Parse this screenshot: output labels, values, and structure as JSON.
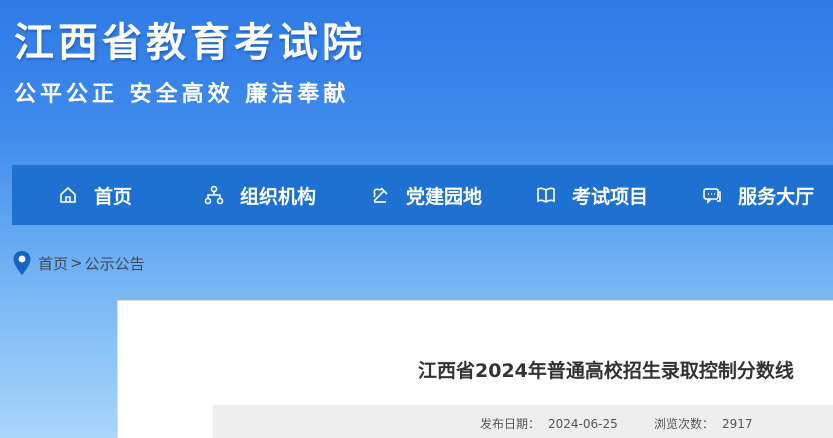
{
  "header": {
    "title": "江西省教育考试院",
    "slogan": "公平公正 安全高效 廉洁奉献"
  },
  "nav": {
    "items": [
      {
        "label": "首页",
        "icon": "home-icon"
      },
      {
        "label": "组织机构",
        "icon": "org-chart-icon"
      },
      {
        "label": "党建园地",
        "icon": "party-building-icon"
      },
      {
        "label": "考试项目",
        "icon": "book-icon"
      },
      {
        "label": "服务大厅",
        "icon": "service-chat-icon"
      }
    ]
  },
  "breadcrumb": {
    "home": "首页",
    "separator": ">",
    "current": "公示公告",
    "icon": "location-pin-icon"
  },
  "article": {
    "title": "江西省2024年普通高校招生录取控制分数线",
    "publish_label": "发布日期：",
    "publish_date": "2024-06-25",
    "views_label": "浏览次数：",
    "views_count": "2917"
  },
  "colors": {
    "nav_bg": "#1e71d0",
    "header_gradient_top": "#2f7be6",
    "header_gradient_bottom": "#a9d6fb",
    "pin_blue": "#1565c0"
  }
}
